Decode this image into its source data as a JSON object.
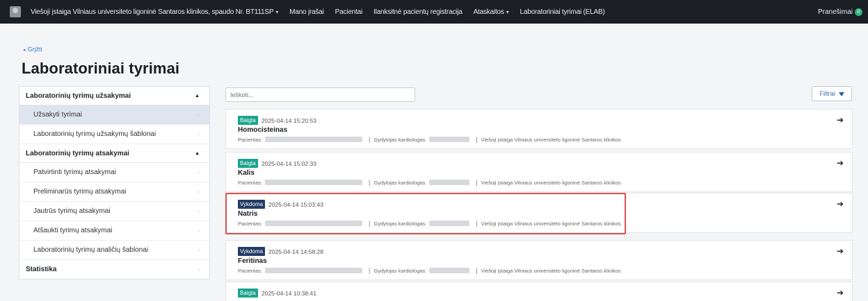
{
  "navbar": {
    "items": [
      {
        "label": "Viešoji įstaiga Vilniaus universiteto ligoninė Santaros klinikos, spaudo Nr. BT111SP",
        "caret": "▾"
      },
      {
        "label": "Mano įrašai",
        "caret": ""
      },
      {
        "label": "Pacientai",
        "caret": ""
      },
      {
        "label": "Ilanksitnė pacientų registracija",
        "caret": ""
      },
      {
        "label": "Ataskaitos",
        "caret": "▾"
      },
      {
        "label": "Laboratoriniai tyrimai (ELAB)",
        "caret": ""
      }
    ],
    "notifications_label": "Pranešimai",
    "notifications_count": "0"
  },
  "back_link": "Grįžti",
  "page_title": "Laboratoriniai tyrimai",
  "sidebar": {
    "sections": [
      {
        "title": "Laboratorinių tyrimų užsakymai",
        "toggle": "▲",
        "items": [
          "Užsakyti tyrimai",
          "Laboratorinių tyrimų užsakymų šablonai"
        ]
      },
      {
        "title": "Laboratorinių tyrimų atsakymai",
        "toggle": "▲",
        "items": [
          "Patvirtinti tyrimų atsakymai",
          "Preliminarūs tyrimų atsakymai",
          "Jautrūs tyrimų atsakymai",
          "Atšaukti tyrimų atsakymai",
          "Laboratorinių tyrimų analičių šablonai"
        ]
      },
      {
        "title": "Statistika",
        "toggle": "›",
        "items": []
      }
    ]
  },
  "search": {
    "placeholder": "Ieškoti..."
  },
  "filter_label": "Filtrai",
  "cards": [
    {
      "status": "Baigta",
      "timestamp": "2025-04-14 15:20:53",
      "title": "Homocisteinas",
      "patient_label": "Pacientas:",
      "doctor_label": "Gydytojas kardiologas:",
      "org": "Viešoji įstaiga Vilniaus universiteto ligoninė Santaros klinikos"
    },
    {
      "status": "Baigta",
      "timestamp": "2025-04-14 15:02:33",
      "title": "Kalis",
      "patient_label": "Pacientas:",
      "doctor_label": "Gydytojas kardiologas:",
      "org": "Viešoji įstaiga Vilniaus universiteto ligoninė Santaros klinikos"
    },
    {
      "status": "Vykdoma",
      "timestamp": "2025-04-14 15:03:43",
      "title": "Natris",
      "patient_label": "Pacientas:",
      "doctor_label": "Gydytojas kardiologas:",
      "org": "Viešoji įstaiga Vilniaus universiteto ligoninė Santaros klinikos"
    },
    {
      "status": "Vykdoma",
      "timestamp": "2025-04-14 14:58:28",
      "title": "Feritinas",
      "patient_label": "Pacientas:",
      "doctor_label": "Gydytojas kardiologas:",
      "org": "Viešoji įstaiga Vilniaus universiteto ligoninė Santaros klinikos"
    },
    {
      "status": "Baigta",
      "timestamp": "2025-04-14 10:38:41",
      "title": "",
      "patient_label": "",
      "doctor_label": "",
      "org": ""
    }
  ],
  "colors": {
    "done": "#1aa38c",
    "running": "#233b66",
    "highlight": "#d9534f",
    "navbar": "#1b1f24"
  },
  "icons": {
    "card_arrow": "arrow-right-icon",
    "filter": "funnel-icon",
    "back": "chevron-left-icon"
  }
}
